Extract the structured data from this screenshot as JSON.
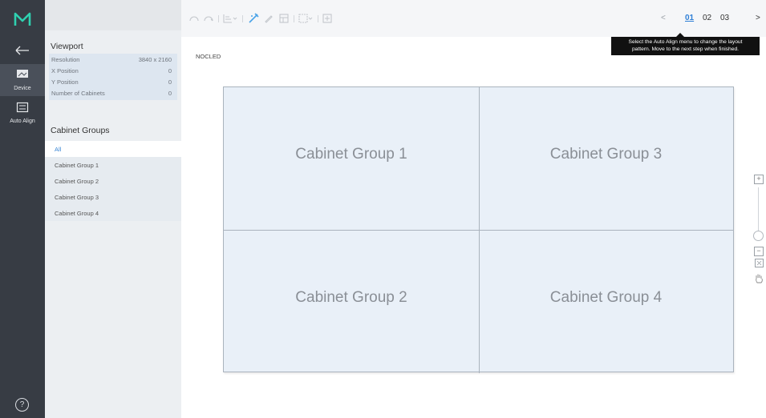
{
  "rail": {
    "device_label": "Device",
    "auto_align_label": "Auto Align",
    "help_glyph": "?"
  },
  "viewport": {
    "title": "Viewport",
    "rows": [
      {
        "label": "Resolution",
        "value": "3840 x 2160"
      },
      {
        "label": "X Position",
        "value": "0"
      },
      {
        "label": "Y Position",
        "value": "0"
      },
      {
        "label": "Number of Cabinets",
        "value": "0"
      }
    ]
  },
  "groups": {
    "title": "Cabinet Groups",
    "items": [
      "All",
      "Cabinet Group 1",
      "Cabinet Group 2",
      "Cabinet Group 3",
      "Cabinet Group 4"
    ],
    "selected": "All"
  },
  "pager": {
    "prev": "<",
    "steps": [
      "01",
      "02",
      "03"
    ],
    "current": "01",
    "next": ">"
  },
  "tooltip": {
    "line1": "Select the Auto Align menu to change the layout",
    "line2": "pattern. Move to the next step when finished."
  },
  "device_name": "NOCLED",
  "canvas": {
    "cells": [
      "Cabinet Group 1",
      "Cabinet Group 3",
      "Cabinet Group 2",
      "Cabinet Group 4"
    ]
  },
  "zoom": {
    "plus": "+",
    "minus": "−",
    "level": 0.0
  },
  "colors": {
    "rail": "#373c44",
    "accent": "#3a86d4",
    "canvas": "#e9f0f8",
    "logo": "#2fd0b0"
  }
}
